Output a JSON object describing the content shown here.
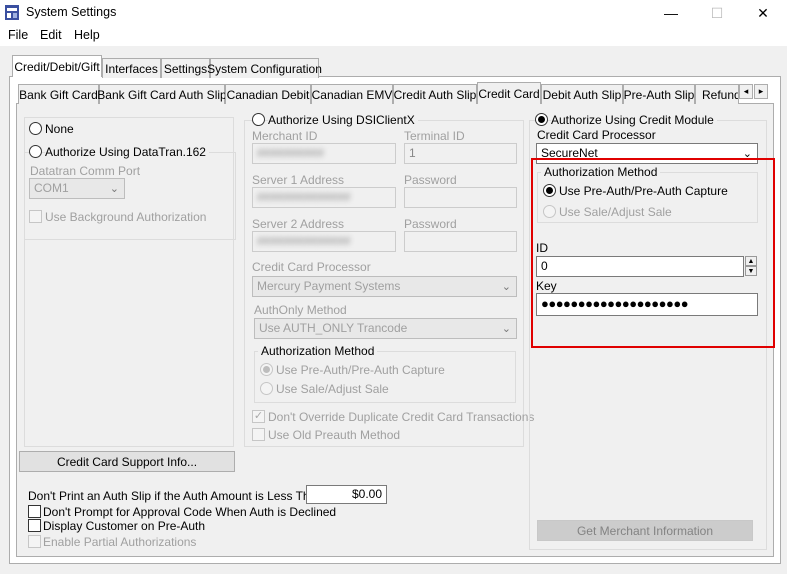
{
  "window": {
    "title": "System Settings",
    "minimize_glyph": "—",
    "maximize_glyph": "☐",
    "close_glyph": "✕"
  },
  "menu": [
    "File",
    "Edit",
    "Help"
  ],
  "top_tabs": [
    "Credit/Debit/Gift",
    "Interfaces",
    "Settings",
    "System Configuration"
  ],
  "sub_tabs": [
    "Bank Gift Card",
    "Bank Gift Card Auth Slip",
    "Canadian Debit",
    "Canadian EMV",
    "Credit Auth Slip",
    "Credit Card",
    "Debit Auth Slip",
    "Pre-Auth Slip",
    "Refund"
  ],
  "scroll": {
    "left": "◂",
    "right": "▸"
  },
  "left": {
    "none_label": "None",
    "datatran_label": "Authorize Using DataTran.162",
    "comm_port_label": "Datatran Comm Port",
    "comm_port_value": "COM1",
    "background_auth_label": "Use Background Authorization",
    "support_button": "Credit Card Support Info..."
  },
  "dsi": {
    "label": "Authorize Using DSIClientX",
    "merchant_id_label": "Merchant ID",
    "merchant_id_value": "##########",
    "terminal_id_label": "Terminal ID",
    "terminal_id_value": "1",
    "server1_label": "Server 1 Address",
    "server1_value": "##############",
    "password1_label": "Password",
    "server2_label": "Server 2 Address",
    "server2_value": "##############",
    "password2_label": "Password",
    "processor_label": "Credit Card Processor",
    "processor_value": "Mercury Payment Systems",
    "authonly_label": "AuthOnly Method",
    "authonly_value": "Use AUTH_ONLY Trancode",
    "auth_method_title": "Authorization Method",
    "preauth_label": "Use Pre-Auth/Pre-Auth Capture",
    "sale_label": "Use Sale/Adjust Sale",
    "dup_label": "Don't Override Duplicate Credit Card Transactions",
    "old_preauth_label": "Use Old Preauth Method"
  },
  "module": {
    "label": "Authorize Using Credit Module",
    "processor_label": "Credit Card Processor",
    "processor_value": "SecureNet",
    "auth_method_title": "Authorization Method",
    "preauth_label": "Use Pre-Auth/Pre-Auth Capture",
    "sale_label": "Use Sale/Adjust Sale",
    "id_label": "ID",
    "id_value": "0",
    "key_label": "Key",
    "key_value": "●●●●●●●●●●●●●●●●●●●●",
    "merchant_button": "Get Merchant Information"
  },
  "bottom": {
    "auth_slip_label": "Don't Print an Auth Slip if the Auth Amount is Less Than",
    "auth_slip_amount": "$0.00",
    "dont_prompt_label": "Don't Prompt for Approval Code When Auth is Declined",
    "display_customer_label": "Display Customer on Pre-Auth",
    "partial_auth_label": "Enable Partial Authorizations"
  },
  "colors": {
    "highlight_box": "#e00000",
    "title_icon": "#3a4fa0"
  }
}
